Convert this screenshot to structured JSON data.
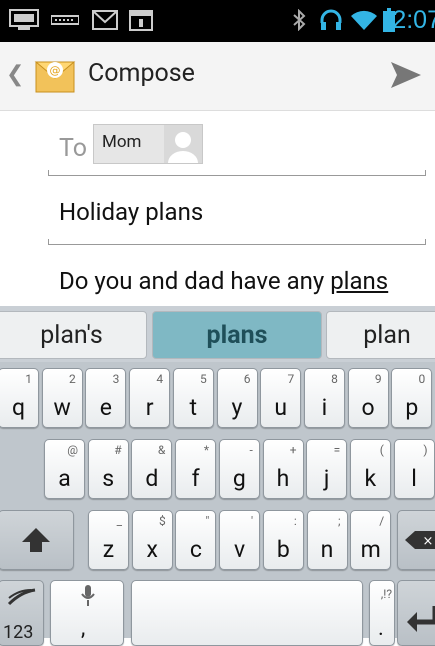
{
  "status_bar": {
    "time": "2:07",
    "icons": [
      "keyboard-icon",
      "voicemail-icon",
      "gmail-icon",
      "calendar-icon",
      "bluetooth-icon",
      "headphones-icon",
      "wifi-icon",
      "battery-icon"
    ],
    "accent_color": "#33b5e5"
  },
  "action_bar": {
    "title": "Compose",
    "back_icon": "chevron-left-icon",
    "app_icon": "email-app-icon",
    "send_icon": "send-icon"
  },
  "compose": {
    "to_label": "To",
    "recipient": "Mom",
    "subject": "Holiday plans",
    "body_prefix": "Do you and dad have any ",
    "body_underlined": "plans"
  },
  "suggestions": [
    "plan's",
    "plans",
    "plan"
  ],
  "keyboard": {
    "row1": [
      {
        "k": "q",
        "h": "1"
      },
      {
        "k": "w",
        "h": "2"
      },
      {
        "k": "e",
        "h": "3"
      },
      {
        "k": "r",
        "h": "4"
      },
      {
        "k": "t",
        "h": "5"
      },
      {
        "k": "y",
        "h": "6"
      },
      {
        "k": "u",
        "h": "7"
      },
      {
        "k": "i",
        "h": "8"
      },
      {
        "k": "o",
        "h": "9"
      },
      {
        "k": "p",
        "h": "0"
      }
    ],
    "row2": [
      {
        "k": "a",
        "h": "@"
      },
      {
        "k": "s",
        "h": "#"
      },
      {
        "k": "d",
        "h": "&"
      },
      {
        "k": "f",
        "h": "*"
      },
      {
        "k": "g",
        "h": "-"
      },
      {
        "k": "h",
        "h": "+"
      },
      {
        "k": "j",
        "h": "="
      },
      {
        "k": "k",
        "h": "("
      },
      {
        "k": "l",
        "h": ")"
      }
    ],
    "row3": [
      {
        "k": "z",
        "h": "_"
      },
      {
        "k": "x",
        "h": "$"
      },
      {
        "k": "c",
        "h": "\""
      },
      {
        "k": "v",
        "h": "'"
      },
      {
        "k": "b",
        "h": ":"
      },
      {
        "k": "n",
        "h": ";"
      },
      {
        "k": "m",
        "h": "/"
      }
    ],
    "symbols_label": "123",
    "comma_label": ",",
    "period_label": ".",
    "period_hint": ",!?"
  }
}
